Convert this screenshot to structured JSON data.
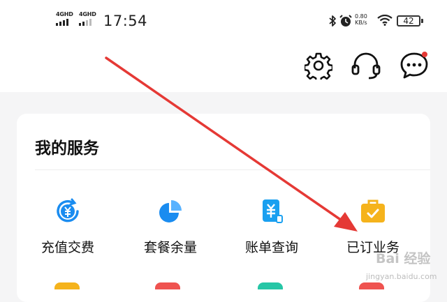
{
  "status_bar": {
    "network_1": "4GHD",
    "network_2": "4GHD",
    "time": "17:54",
    "net_speed_value": "0.80",
    "net_speed_unit": "KB/s",
    "battery": "42"
  },
  "header": {
    "icons": [
      "gear-icon",
      "headset-icon",
      "message-icon"
    ]
  },
  "services": {
    "title": "我的服务",
    "items": [
      {
        "label": "充值交费",
        "icon": "recharge-icon",
        "color": "#1a8cf0"
      },
      {
        "label": "套餐余量",
        "icon": "pie-chart-icon",
        "color": "#1a8cf0"
      },
      {
        "label": "账单查询",
        "icon": "bill-icon",
        "color": "#1a8cf0"
      },
      {
        "label": "已订业务",
        "icon": "briefcase-icon",
        "color": "#f5b31c"
      }
    ]
  },
  "annotation": {
    "arrow_color": "#e53935"
  },
  "watermark": {
    "text": "Bai 经验",
    "url": "jingyan.baidu.com"
  }
}
